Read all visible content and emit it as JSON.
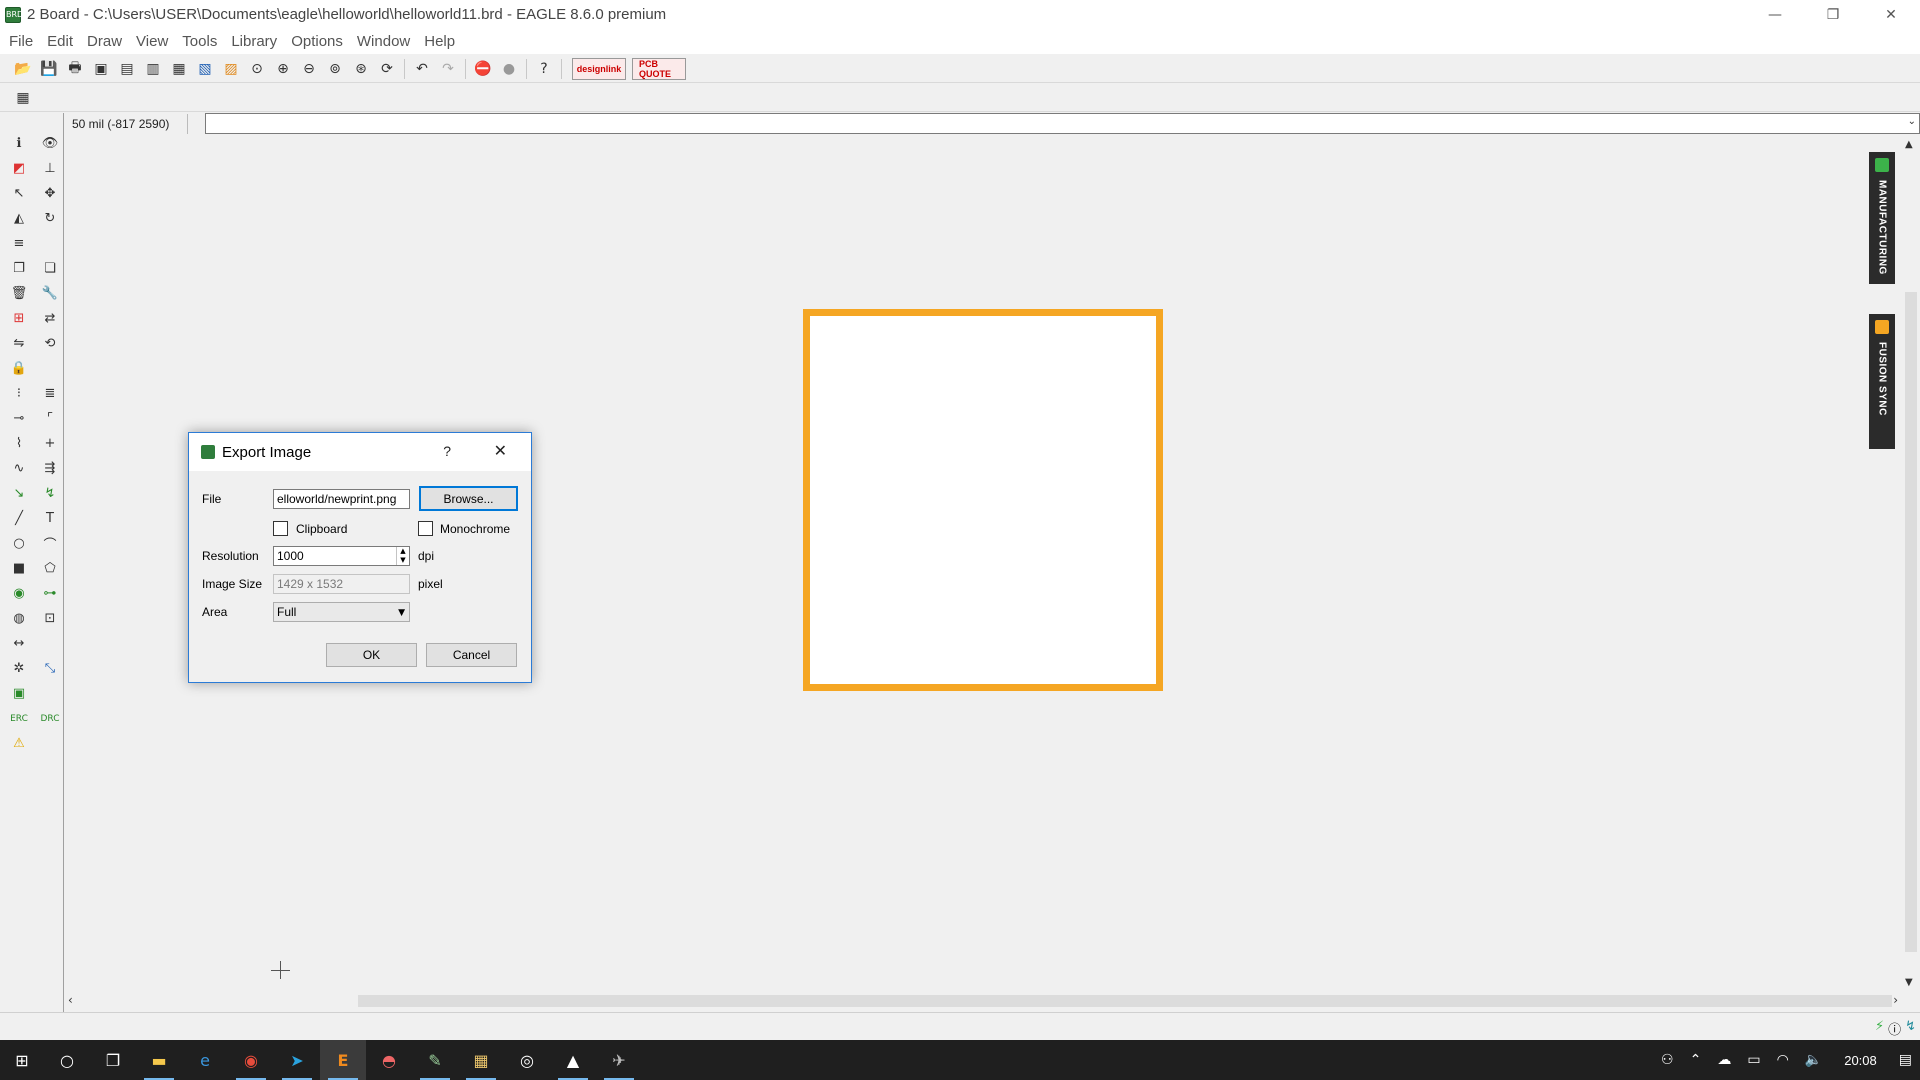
{
  "window": {
    "title": "2 Board - C:\\Users\\USER\\Documents\\eagle\\helloworld\\helloworld11.brd - EAGLE 8.6.0 premium",
    "app_icon_text": "BRD",
    "controls": {
      "minimize": "—",
      "restore": "❐",
      "close": "✕"
    }
  },
  "menu": [
    "File",
    "Edit",
    "Draw",
    "View",
    "Tools",
    "Library",
    "Options",
    "Window",
    "Help"
  ],
  "toolbar": {
    "buttons": [
      "open-icon",
      "save-icon",
      "print-icon",
      "cam-icon",
      "script-icon",
      "ulp-icon",
      "grid-icon",
      "layer-icon",
      "zoom-fit-icon",
      "zoom-in-icon",
      "zoom-out-icon",
      "zoom-select-icon",
      "zoom-redraw-icon",
      "redraw-icon",
      "undo-icon",
      "redo-icon",
      "stop-icon",
      "go-icon",
      "help-icon"
    ],
    "designlink_label": "designlink",
    "pcbquote_label": "PCB QUOTE"
  },
  "command_line": {
    "coords": "50 mil (-817 2590)",
    "value": ""
  },
  "side_tabs": {
    "manufacturing": "MANUFACTURING",
    "fusion_sync": "FUSION SYNC"
  },
  "dialog": {
    "title": "Export Image",
    "help": "?",
    "close": "✕",
    "file_label": "File",
    "file_value": "elloworld/newprint.png",
    "browse_label": "Browse...",
    "clipboard_label": "Clipboard",
    "monochrome_label": "Monochrome",
    "resolution_label": "Resolution",
    "resolution_value": "1000",
    "resolution_unit": "dpi",
    "image_size_label": "Image Size",
    "image_size_value": "1429 x 1532",
    "image_size_unit": "pixel",
    "area_label": "Area",
    "area_value": "Full",
    "ok_label": "OK",
    "cancel_label": "Cancel"
  },
  "colors": {
    "board_outline": "#f5a623",
    "dialog_border": "#2b7bd6",
    "taskbar": "#1f1f1f"
  },
  "taskbar": {
    "apps": [
      "start-icon",
      "cortana-icon",
      "task-view-icon",
      "file-explorer-icon",
      "edge-icon",
      "chrome-icon",
      "telegram-icon",
      "eagle-icon",
      "app-icon",
      "app2-icon",
      "notes-icon",
      "camera-icon",
      "photos-icon",
      "eagle2-icon"
    ],
    "clock": "20:08"
  }
}
